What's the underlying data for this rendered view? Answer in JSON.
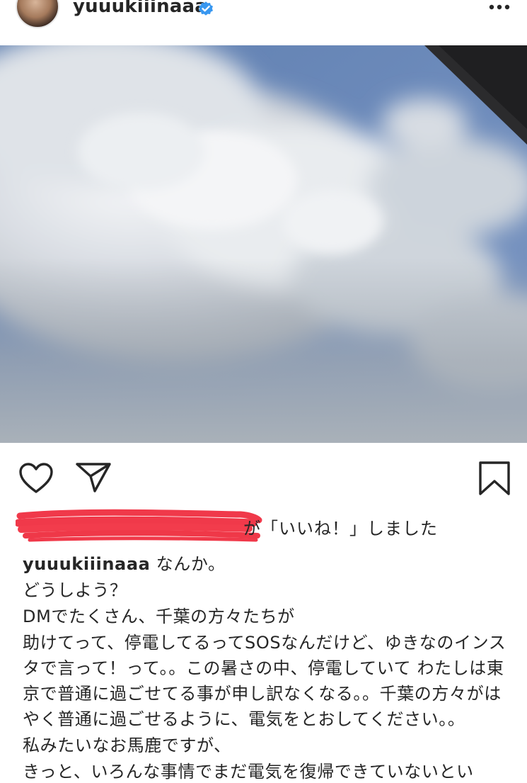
{
  "post": {
    "username": "yuuukiiinaaa",
    "likes_suffix": "が「いいね！」しました",
    "caption_username": "yuuukiiinaaa",
    "caption_first": "なんか。",
    "caption_lines": [
      "どうしよう？",
      "DMでたくさん、千葉の方々たちが",
      "助けてって、停電してるってSOSなんだけど、ゆきなのインスタで言って！って。。この暑さの中、停電していて わたしは東京で普通に過ごせてる事が申し訳なくなる。。千葉の方々がはやく普通に過ごせるように、電気をとおしてください。。",
      "私みたいなお馬鹿ですが、",
      "きっと、いろんな事情でまだ電気を復帰できていないとい"
    ]
  },
  "icons": {
    "verified": "verified-badge-icon",
    "more": "more-options-icon",
    "like": "heart-icon",
    "share": "send-icon",
    "save": "bookmark-icon"
  },
  "colors": {
    "verified_blue": "#3897f0",
    "text": "#262626",
    "redaction": "#f0394a"
  }
}
